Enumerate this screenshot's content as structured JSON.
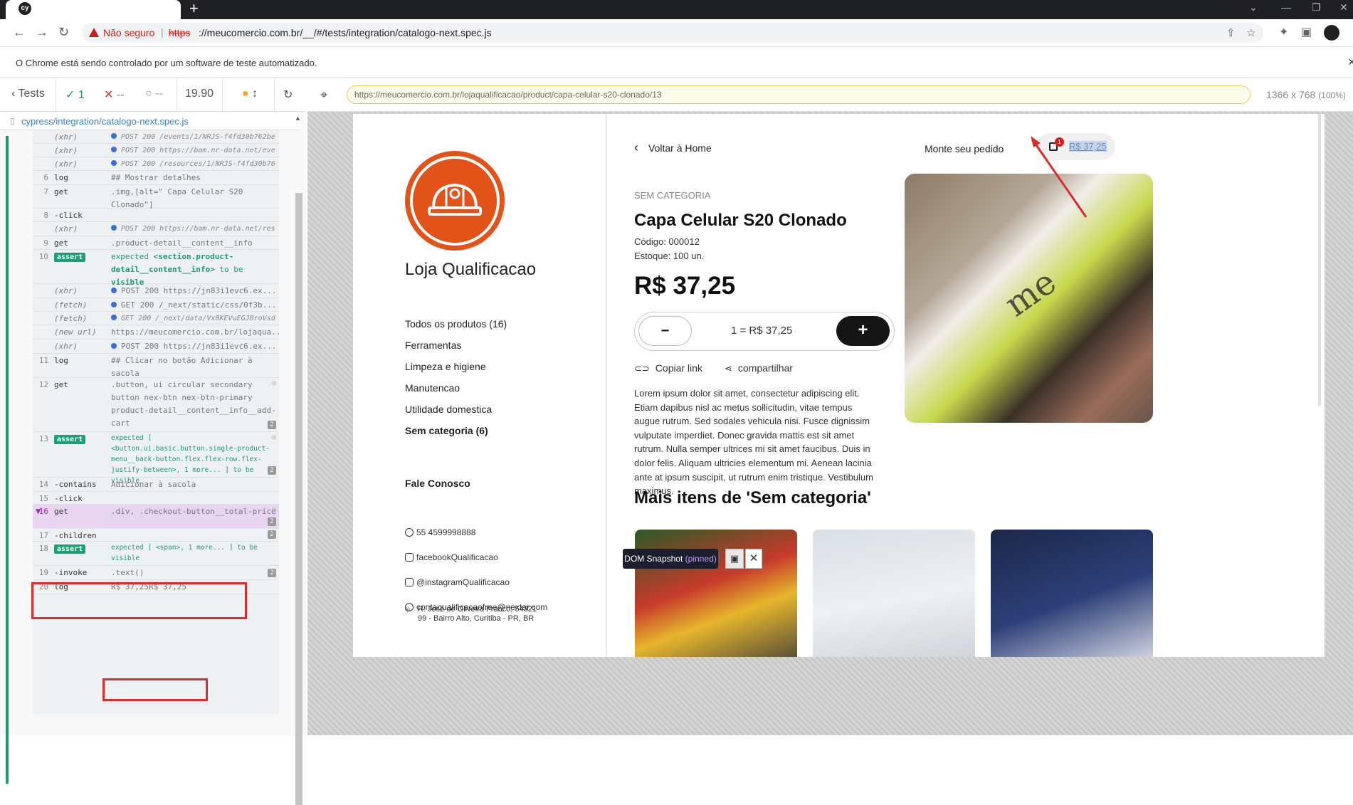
{
  "browser": {
    "tab_favicon": "cy",
    "new_tab": "+",
    "window_controls": [
      "⌄",
      "—",
      "❐",
      "✕"
    ],
    "insecure_label": "Não seguro",
    "url_https": "https",
    "url_rest": "://meucomercio.com.br/__/#/tests/integration/catalogo-next.spec.js",
    "infobar_text": "O Chrome está sendo controlado por um software de teste automatizado.",
    "infobar_close": "×",
    "icons": [
      "back-arrow-icon",
      "forward-arrow-icon",
      "reload-icon",
      "warning-icon",
      "share-icon",
      "star-icon",
      "extensions-icon",
      "sidepanel-icon",
      "profile-icon"
    ]
  },
  "cypress": {
    "tests_label": "Tests",
    "passed": "1",
    "failed": "--",
    "pending": "--",
    "duration": "19.90",
    "spec_file": "cypress/integration/catalogo-next.spec.js",
    "aut_url": "https://meucomercio.com.br/lojaqualificacao/product/capa-celular-s20-clonado/13",
    "viewport": "1366 x 768",
    "viewport_pct": "(100%)",
    "log": [
      {
        "num": "",
        "name": "(xhr)",
        "msg": "POST 200 /events/1/NRJS-f4fd30b762be...",
        "type": "xhr-small"
      },
      {
        "num": "",
        "name": "(xhr)",
        "msg": "POST 200 https://bam.nr-data.net/eve...",
        "type": "xhr-small"
      },
      {
        "num": "",
        "name": "(xhr)",
        "msg": "POST 200 /resources/1/NRJS-f4fd30b76...",
        "type": "xhr-small"
      },
      {
        "num": "6",
        "name": "log",
        "msg": "## Mostrar detalhes"
      },
      {
        "num": "7",
        "name": "get",
        "msg": ".img,[alt=\" Capa Celular S20 Clonado\"]"
      },
      {
        "num": "8",
        "name": "-click",
        "msg": ""
      },
      {
        "num": "",
        "name": "(xhr)",
        "msg": "POST 200 https://bam.nr-data.net/res...",
        "type": "xhr-small"
      },
      {
        "num": "9",
        "name": "get",
        "msg": ".product-detail__content__info"
      },
      {
        "num": "10",
        "name": "assert",
        "msg_expected": "expected",
        "msg_el": "<section.product-detail__content__info>",
        "msg_tobe": "to be",
        "msg_kw": "visible"
      },
      {
        "num": "",
        "name": "(xhr)",
        "msg": "POST 200 https://jn83i1evc6.ex...",
        "type": "xhr"
      },
      {
        "num": "",
        "name": "(fetch)",
        "msg": "GET 200 /_next/static/css/0f3b...",
        "type": "xhr"
      },
      {
        "num": "",
        "name": "(fetch)",
        "msg": "GET 200 /_next/data/Vx8KEVuEGJ8roVsd...",
        "type": "xhr-small"
      },
      {
        "num": "",
        "name": "(new url)",
        "msg": "https://meucomercio.com.br/lojaqua..."
      },
      {
        "num": "",
        "name": "(xhr)",
        "msg": "POST 200 https://jn83i1evc6.ex...",
        "type": "xhr"
      },
      {
        "num": "11",
        "name": "log",
        "msg": "## Clicar no botão Adicionar à sacola"
      },
      {
        "num": "12",
        "name": "get",
        "msg": ".button, ui circular secondary button nex-btn nex-btn-primary product-detail__content__info__add-cart",
        "count": "2"
      },
      {
        "num": "13",
        "name": "assert",
        "msg": "expected [ <button.ui.basic.button.single-product-menu__back-button.flex.flex-row.flex-justify-between>, 1 more... ] to be visible",
        "count": "2"
      },
      {
        "num": "14",
        "name": "-contains",
        "msg": "Adicionar à sacola"
      },
      {
        "num": "15",
        "name": "-click",
        "msg": ""
      },
      {
        "num": "16",
        "name": "get",
        "msg": ".div, .checkout-button__total-price",
        "count": "2"
      },
      {
        "num": "17",
        "name": "-children",
        "msg": "",
        "count": "2"
      },
      {
        "num": "18",
        "name": "assert",
        "msg": "expected [ <span>, 1 more... ] to be visible"
      },
      {
        "num": "19",
        "name": "-invoke",
        "msg": ".text()",
        "count": "2"
      },
      {
        "num": "20",
        "name": "log",
        "msg": "R$ 37,25R$ 37,25"
      }
    ],
    "snapshot_label": "DOM Snapshot",
    "snapshot_pinned": "(pinned)",
    "snapshot_close": "✕"
  },
  "store": {
    "name": "Loja Qualificacao",
    "categories": [
      {
        "label": "Todos os produtos (16)",
        "active": false
      },
      {
        "label": "Ferramentas",
        "active": false
      },
      {
        "label": "Limpeza e higiene",
        "active": false
      },
      {
        "label": "Manutencao",
        "active": false
      },
      {
        "label": "Utilidade domestica",
        "active": false
      },
      {
        "label": "Sem categoria (6)",
        "active": true
      }
    ],
    "contact_title": "Fale Conosco",
    "contacts": [
      "55 4599998888",
      "facebookQualificacao",
      "@instagramQualificacao",
      "contaqualificacaofree@nextar.com"
    ],
    "address_line1": "R. José de Oliveira Franco, 54321",
    "address_line2": "99 - Bairro Alto, Curitiba - PR, BR",
    "back_home": "Voltar à Home",
    "monte_pedido": "Monte seu pedido",
    "cart_count": "1",
    "cart_total": "R$ 37,25",
    "category_tag": "SEM CATEGORIA",
    "product_title": "Capa Celular S20 Clonado",
    "codigo": "Código: 000012",
    "estoque": "Estoque: 100 un.",
    "price": "R$ 37,25",
    "qty_minus": "−",
    "qty_label": "1 = R$ 37,25",
    "qty_plus": "+",
    "copy_link": "Copiar link",
    "share": "compartilhar",
    "description": "Lorem ipsum dolor sit amet, consectetur adipiscing elit. Etiam dapibus nisl ac metus sollicitudin, vitae tempus augue rutrum. Sed sodales vehicula nisi. Fusce dignissim vulputate imperdiet. Donec gravida mattis est sit amet rutrum. Nulla semper ultrices mi sit amet faucibus. Duis in dolor felis. Aliquam ultricies elementum mi. Aenean lacinia ante at ipsum suscipit, ut rutrum enim tristique. Vestibulum maximus.",
    "more_title": "Mais itens de 'Sem categoria'",
    "image_text": "me",
    "colors": {
      "brand_orange": "#e2531a",
      "cart_badge": "#d61b1b",
      "annotation_red": "#d32f2f"
    }
  }
}
